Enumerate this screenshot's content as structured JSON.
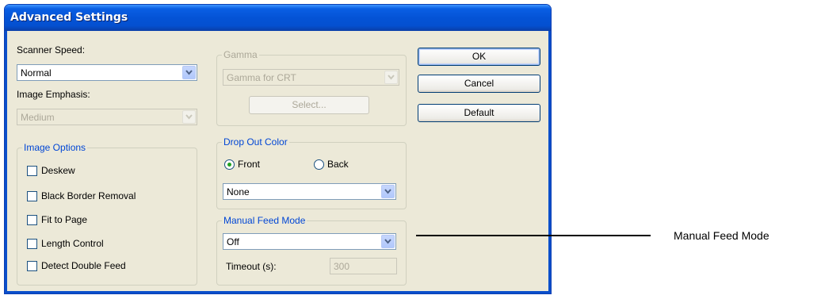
{
  "dialog": {
    "title": "Advanced Settings"
  },
  "scanner_speed": {
    "label": "Scanner Speed:",
    "value": "Normal"
  },
  "image_emphasis": {
    "label": "Image Emphasis:",
    "value": "Medium"
  },
  "image_options": {
    "legend": "Image Options",
    "items": [
      "Deskew",
      "Black Border Removal",
      "Fit to Page",
      "Length Control",
      "Detect Double Feed"
    ]
  },
  "gamma": {
    "legend": "Gamma",
    "value": "Gamma for CRT",
    "select_label": "Select..."
  },
  "drop_out_color": {
    "legend": "Drop Out Color",
    "front_label": "Front",
    "back_label": "Back",
    "value": "None"
  },
  "manual_feed": {
    "legend": "Manual Feed Mode",
    "value": "Off",
    "timeout_label": "Timeout (s):",
    "timeout_value": "300"
  },
  "buttons": {
    "ok": "OK",
    "cancel": "Cancel",
    "default": "Default"
  },
  "callout": {
    "text": "Manual Feed Mode"
  }
}
